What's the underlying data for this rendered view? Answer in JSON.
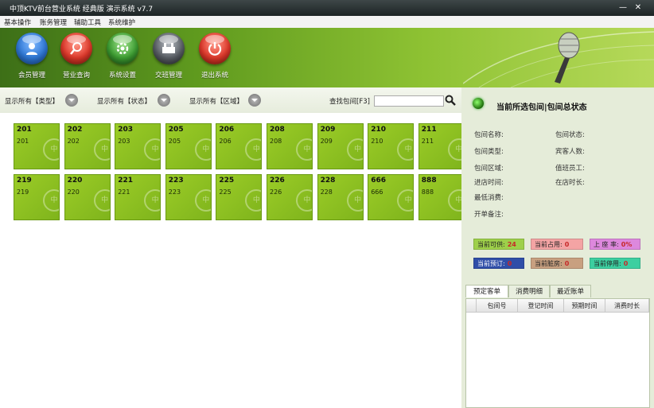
{
  "window": {
    "title": "中顶KTV前台营业系统 经典版 演示系统 v7.7",
    "minimize": "—",
    "close": "✕"
  },
  "menu": [
    "基本操作",
    "账务管理",
    "辅助工具",
    "系统维护"
  ],
  "toolbar": [
    {
      "label": "会员管理",
      "icon": "user-icon",
      "color": "#2f78d6"
    },
    {
      "label": "营业查询",
      "icon": "magnifier-icon",
      "color": "#e0392b"
    },
    {
      "label": "系统设置",
      "icon": "gear-icon",
      "color": "#3ea033"
    },
    {
      "label": "交班管理",
      "icon": "handover-icon",
      "color": "#5a5f66"
    },
    {
      "label": "退出系统",
      "icon": "power-icon",
      "color": "#e0392b"
    }
  ],
  "filters": {
    "type": "显示所有【类型】",
    "status": "显示所有【状态】",
    "area": "显示所有【区域】",
    "search_label": "查找包间[F3]",
    "search_value": ""
  },
  "rooms": [
    {
      "number": "201",
      "sub": "201"
    },
    {
      "number": "202",
      "sub": "202"
    },
    {
      "number": "203",
      "sub": "203"
    },
    {
      "number": "205",
      "sub": "205"
    },
    {
      "number": "206",
      "sub": "206"
    },
    {
      "number": "208",
      "sub": "208"
    },
    {
      "number": "209",
      "sub": "209"
    },
    {
      "number": "210",
      "sub": "210"
    },
    {
      "number": "211",
      "sub": "211"
    },
    {
      "number": "219",
      "sub": "219"
    },
    {
      "number": "220",
      "sub": "220"
    },
    {
      "number": "221",
      "sub": "221"
    },
    {
      "number": "223",
      "sub": "223"
    },
    {
      "number": "225",
      "sub": "225"
    },
    {
      "number": "226",
      "sub": "226"
    },
    {
      "number": "228",
      "sub": "228"
    },
    {
      "number": "666",
      "sub": "666"
    },
    {
      "number": "888",
      "sub": "888"
    }
  ],
  "room_watermark": "中",
  "panel": {
    "title": "当前所选包间|包间总状态",
    "fields_left": [
      "包间名称:",
      "包间类型:",
      "包间区域:",
      "进店时间:",
      "最低消费:",
      "开单备注:"
    ],
    "fields_right": [
      "包间状态:",
      "宾客人数:",
      "值班员工:",
      "在店时长:"
    ]
  },
  "stats": [
    {
      "label": "当前可供:",
      "value": "24",
      "bg": "#9ed04a",
      "vc": "#c62828"
    },
    {
      "label": "当前占用:",
      "value": "0",
      "bg": "#f4a4a4",
      "vc": "#c62828"
    },
    {
      "label": "上 座 率:",
      "value": "0%",
      "bg": "#dd88dd",
      "vc": "#c62828"
    },
    {
      "label": "当前预订:",
      "value": "0",
      "bg": "#2f4ea8",
      "vc": "#c62828"
    },
    {
      "label": "当前脏房:",
      "value": "0",
      "bg": "#c8a080",
      "vc": "#c62828"
    },
    {
      "label": "当前停用:",
      "value": "0",
      "bg": "#3ccfa0",
      "vc": "#c62828"
    }
  ],
  "tabs": [
    "预定客单",
    "消费明细",
    "最近账单"
  ],
  "table_headers": [
    "",
    "包间号",
    "登记时间",
    "预期时间",
    "消费时长"
  ]
}
